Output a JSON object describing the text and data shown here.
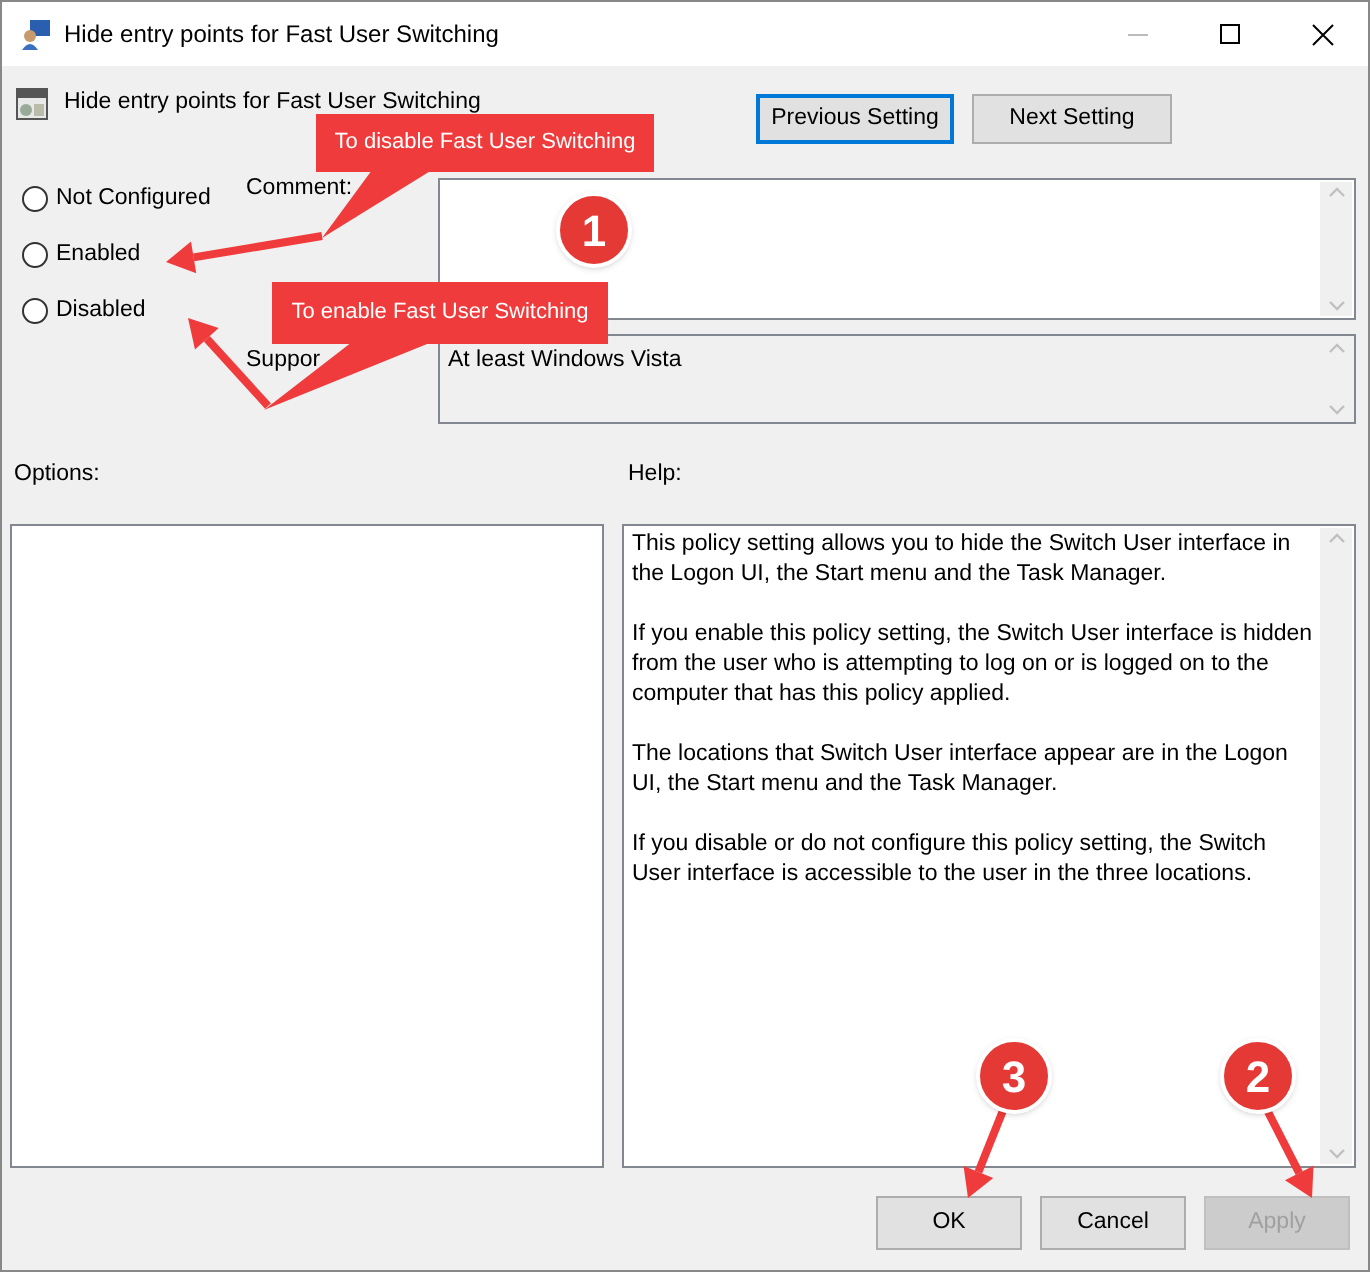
{
  "window": {
    "title": "Hide entry points for Fast User Switching"
  },
  "header": {
    "title": "Hide entry points for Fast User Switching"
  },
  "nav_buttons": [
    {
      "label": "Previous Setting",
      "focused": true
    },
    {
      "label": "Next Setting",
      "focused": false
    }
  ],
  "options": [
    {
      "label": "Not Configured",
      "selected": false
    },
    {
      "label": "Enabled",
      "selected": false
    },
    {
      "label": "Disabled",
      "selected": false
    }
  ],
  "comment": {
    "label": "Comment:"
  },
  "supported_on": {
    "label": "Suppor",
    "value": "At least Windows Vista"
  },
  "options_label": "Options:",
  "help_label": "Help:",
  "help_text": [
    "This policy setting allows you to hide the Switch User interface in the Logon UI, the Start menu and the Task Manager.",
    "If you enable this policy setting, the Switch User interface is hidden from the user who is attempting to log on or is logged on to the computer that has this policy applied.",
    "The locations that Switch User interface appear are in the Logon UI, the Start menu and the Task Manager.",
    "If you disable or do not configure this policy setting, the Switch User interface is accessible to the user in the three locations."
  ],
  "buttons": [
    {
      "label": "OK",
      "disabled": false
    },
    {
      "label": "Cancel",
      "disabled": false
    },
    {
      "label": "Apply",
      "disabled": true
    }
  ],
  "annotations": {
    "callouts": [
      "To disable Fast User Switching",
      "To enable Fast User Switching"
    ],
    "badges": [
      "1",
      "3",
      "2"
    ]
  }
}
